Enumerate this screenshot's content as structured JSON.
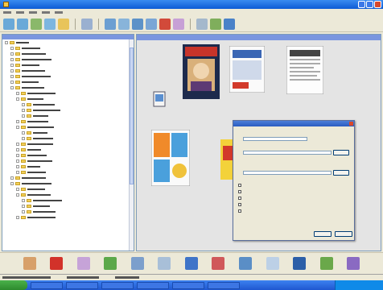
{
  "colors": {
    "title_bar": "#0d5bd5",
    "pane_header": "#7a96df",
    "taskbar": "#1f57d0",
    "start_button": "#2d8a2d"
  },
  "toolbar": {
    "icons": [
      "back-icon",
      "forward-icon",
      "up-icon",
      "refresh-icon",
      "folder-icon",
      "view-icon",
      "sort-icon",
      "filter-icon",
      "rotate-icon",
      "delete-icon",
      "copy-icon",
      "move-icon",
      "print-icon",
      "help-icon"
    ]
  },
  "bottom_bar": {
    "icons": [
      "arrow-left-icon",
      "stop-icon",
      "filter-icon",
      "image-icon",
      "grid-icon",
      "edit-icon",
      "document-icon",
      "import-icon",
      "scanner-icon",
      "magnify-icon",
      "upload-icon",
      "book-icon",
      "zoom-icon"
    ]
  }
}
